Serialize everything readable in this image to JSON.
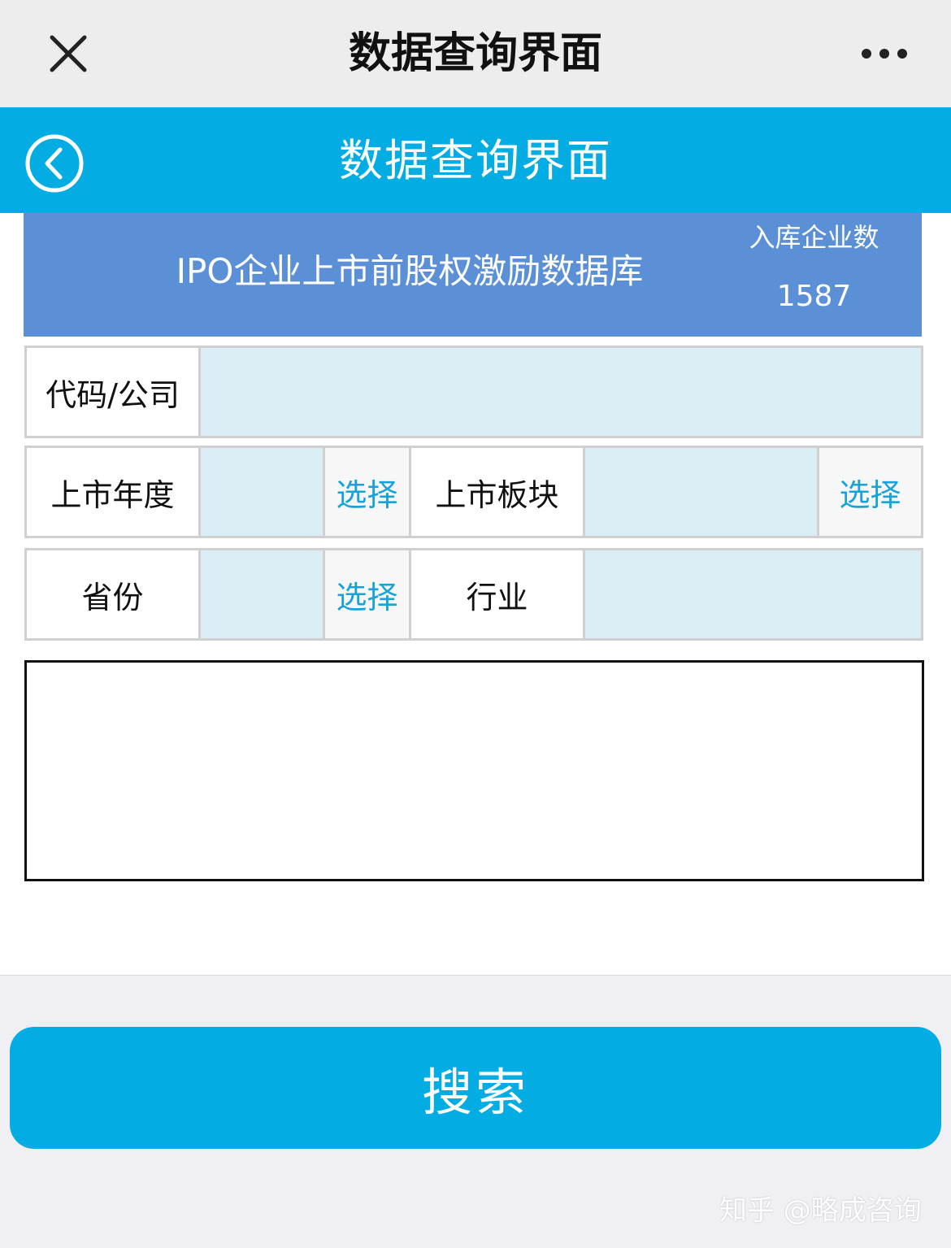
{
  "topbar": {
    "title": "数据查询界面",
    "close_icon": "close-icon",
    "more_icon": "more-horizontal-icon"
  },
  "appbar": {
    "title": "数据查询界面",
    "back_icon": "chevron-left-circle-icon"
  },
  "banner": {
    "title": "IPO企业上市前股权激励数据库",
    "count_label": "入库企业数",
    "count_value": "1587"
  },
  "form": {
    "code_label": "代码/公司",
    "code_value": "",
    "year_label": "上市年度",
    "year_value": "",
    "year_pick": "选择",
    "board_label": "上市板块",
    "board_value": "",
    "board_pick": "选择",
    "province_label": "省份",
    "province_value": "",
    "province_pick": "选择",
    "industry_label": "行业",
    "industry_value": ""
  },
  "search_label": "搜索",
  "watermark": "知乎 @略成咨询",
  "colors": {
    "header_blue": "#03ade3",
    "banner_blue": "#5b8fd6",
    "input_bg": "#dbeef5",
    "pick_text": "#17a2d8"
  }
}
